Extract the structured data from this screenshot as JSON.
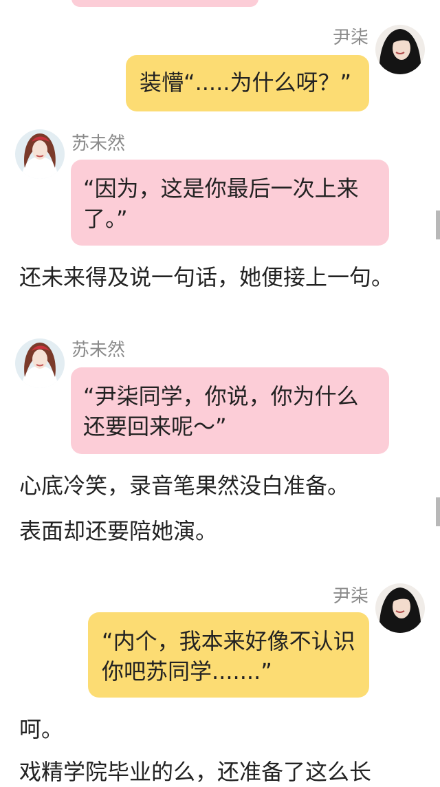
{
  "colors": {
    "pink_bubble": "#fccdd7",
    "yellow_bubble": "#fcdc73",
    "name_text": "#8a8a8a",
    "body_text": "#222222",
    "scroll_indicator": "#b8b8b8"
  },
  "messages": [
    {
      "sender": "尹柒",
      "text": "装懵“.....为什么呀？”",
      "side": "right",
      "bubble": "yellow",
      "avatar": "avatar-yinqi"
    },
    {
      "sender": "苏未然",
      "text": "“因为，这是你最后一次上来了。”",
      "side": "left",
      "bubble": "pink",
      "avatar": "avatar-suweiran"
    },
    {
      "sender": "苏未然",
      "text": "“尹柒同学，你说，你为什么还要回来呢～”",
      "side": "left",
      "bubble": "pink",
      "avatar": "avatar-suweiran"
    },
    {
      "sender": "尹柒",
      "text": "“内个，我本来好像不认识你吧苏同学.......”",
      "side": "right",
      "bubble": "yellow",
      "avatar": "avatar-yinqi"
    }
  ],
  "narration": [
    "还未来得及说一句话，她便接上一句。",
    "心底冷笑，录音笔果然没白准备。",
    "表面却还要陪她演。",
    "呵。",
    "戏精学院毕业的么，还准备了这么长"
  ]
}
